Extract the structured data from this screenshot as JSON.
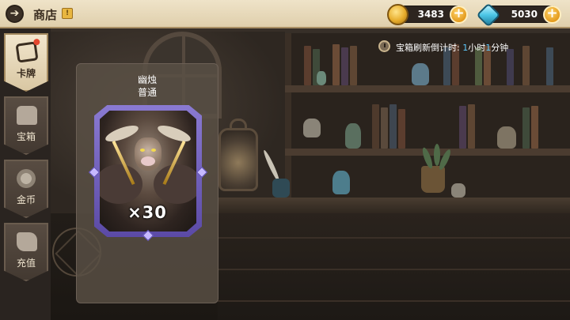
{
  "header": {
    "title": "商店",
    "back_icon": "arrow-left-icon",
    "info_icon": "info-icon"
  },
  "resources": {
    "gold": {
      "value": "3483",
      "icon": "gold-coin-icon",
      "add_icon": "plus-icon"
    },
    "gems": {
      "value": "5030",
      "icon": "blue-gem-icon",
      "add_icon": "plus-icon"
    }
  },
  "timer": {
    "label": "宝箱刷新倒计时: ",
    "hours": "1",
    "hours_unit": "小时",
    "minutes": "1",
    "minutes_unit": "分钟"
  },
  "sidebar": {
    "tabs": [
      {
        "label": "卡牌",
        "icon": "cards-icon",
        "active": true
      },
      {
        "label": "宝箱",
        "icon": "chest-icon",
        "active": false
      },
      {
        "label": "金币",
        "icon": "coin-icon",
        "active": false
      },
      {
        "label": "充值",
        "icon": "recharge-icon",
        "active": false
      }
    ]
  },
  "item": {
    "name": "幽烛",
    "rarity": "普通",
    "quantity": "×30"
  },
  "colors": {
    "accent_gold": "#e39b1e",
    "highlight_blue": "#5ecbff",
    "card_frame": "#5b4aa6",
    "notification_red": "#e3462e"
  }
}
